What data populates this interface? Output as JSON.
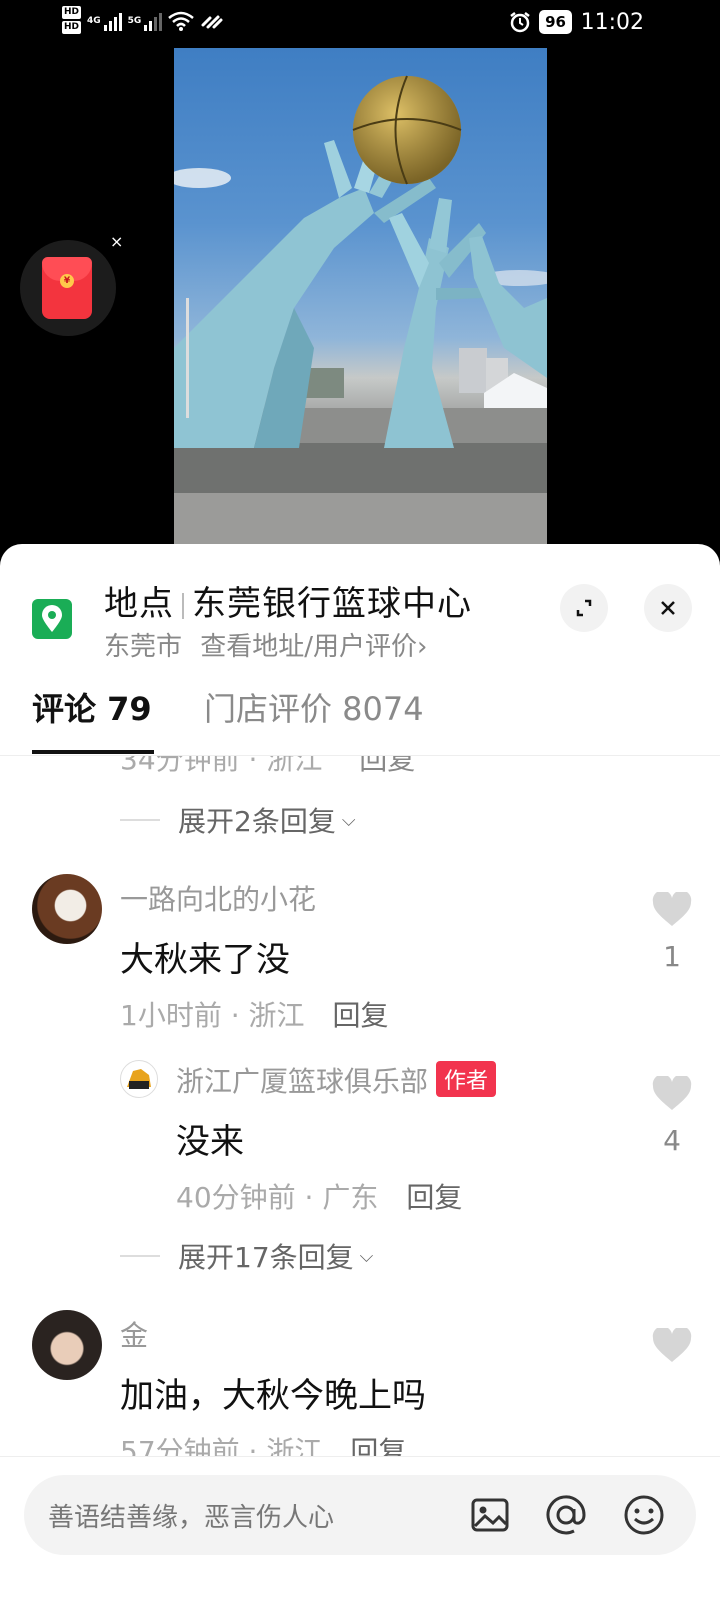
{
  "status_bar": {
    "hd1": "HD",
    "hd2": "HD",
    "net1": "4G",
    "net2": "5G",
    "battery": "96",
    "time": "11:02"
  },
  "location": {
    "label": "地点",
    "name": "东莞银行篮球中心",
    "city": "东莞市",
    "link": "查看地址/用户评价",
    "link_chevron": "›"
  },
  "tabs": [
    {
      "label": "评论 79",
      "active": true
    },
    {
      "label": "门店评价 8074",
      "active": false
    }
  ],
  "comments": {
    "faded_row": {
      "time": "34分钟前 · 浙江",
      "reply": "回复"
    },
    "expand_top": "展开2条回复",
    "items": [
      {
        "name": "一路向北的小花",
        "text": "大秋来了没",
        "meta": "1小时前 · 浙江",
        "reply": "回复",
        "likes": "1",
        "replies": [
          {
            "name": "浙江广厦篮球俱乐部",
            "badge": "作者",
            "text": "没来",
            "meta": "40分钟前 · 广东",
            "reply": "回复",
            "likes": "4"
          }
        ],
        "expand": "展开17条回复"
      },
      {
        "name": "金",
        "text": "加油，大秋今晚上吗",
        "meta": "57分钟前 · 浙江",
        "reply": "回复",
        "likes": ""
      }
    ]
  },
  "input": {
    "placeholder": "善语结善缘，恶言伤人心"
  },
  "colors": {
    "accent_green": "#1aad56",
    "badge_red": "#f2344e",
    "red_packet": "#f3343e"
  }
}
